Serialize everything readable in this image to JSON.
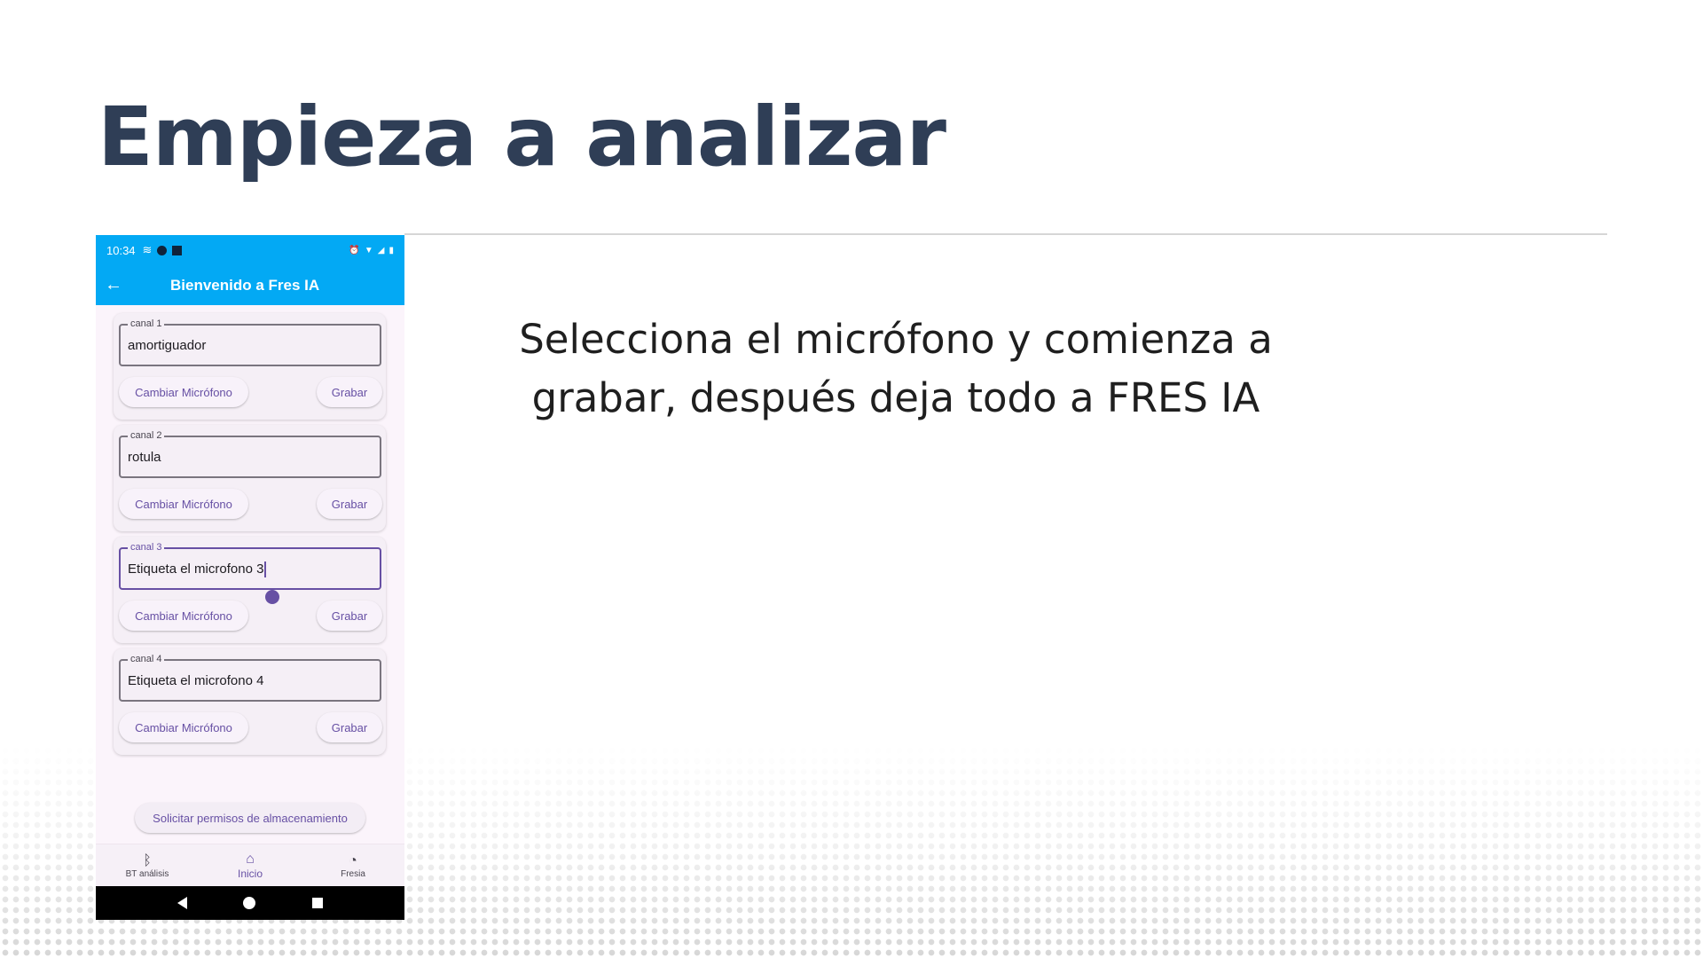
{
  "slide": {
    "title": "Empieza a analizar",
    "description": "Selecciona el micrófono y comienza a grabar, después deja todo a FRES IA"
  },
  "status_bar": {
    "time": "10:34"
  },
  "app_bar": {
    "title": "Bienvenido a Fres IA",
    "back_icon": "arrow-left-icon"
  },
  "channels": [
    {
      "label": "canal 1",
      "value": "amortiguador",
      "change_label": "Cambiar Micrófono",
      "record_label": "Grabar",
      "focused": false
    },
    {
      "label": "canal 2",
      "value": "rotula",
      "change_label": "Cambiar Micrófono",
      "record_label": "Grabar",
      "focused": false
    },
    {
      "label": "canal 3",
      "value": "Etiqueta el microfono 3",
      "change_label": "Cambiar Micrófono",
      "record_label": "Grabar",
      "focused": true
    },
    {
      "label": "canal 4",
      "value": "Etiqueta el microfono 4",
      "change_label": "Cambiar Micrófono",
      "record_label": "Grabar",
      "focused": false
    }
  ],
  "permissions_button": "Solicitar permisos de almacenamiento",
  "bottom_nav": [
    {
      "label": "BT análisis",
      "icon": "bluetooth-audio-icon"
    },
    {
      "label": "Inicio",
      "icon": "home-icon",
      "active": true
    },
    {
      "label": "Fresia",
      "icon": "analytics-icon"
    }
  ],
  "colors": {
    "title": "#2f3e56",
    "app_bar": "#03a9f4",
    "accent": "#6750a4"
  }
}
